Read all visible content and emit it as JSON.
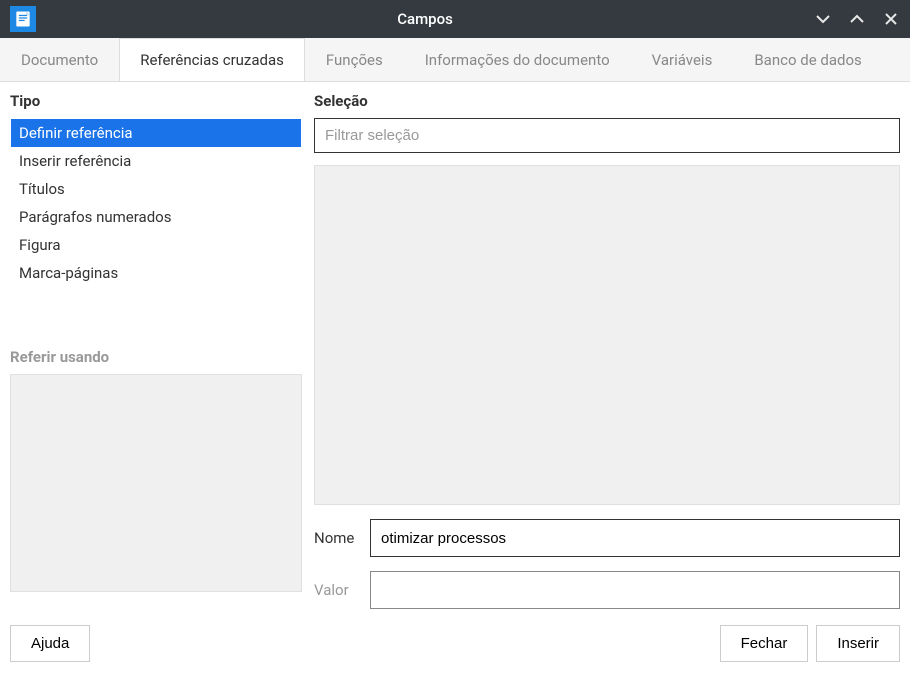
{
  "window": {
    "title": "Campos"
  },
  "tabs": [
    {
      "label": "Documento"
    },
    {
      "label": "Referências cruzadas"
    },
    {
      "label": "Funções"
    },
    {
      "label": "Informações do documento"
    },
    {
      "label": "Variáveis"
    },
    {
      "label": "Banco de dados"
    }
  ],
  "active_tab_index": 1,
  "left": {
    "type_header": "Tipo",
    "type_items": [
      "Definir referência",
      "Inserir referência",
      "Títulos",
      "Parágrafos numerados",
      "Figura",
      "Marca-páginas"
    ],
    "selected_type_index": 0,
    "refer_header": "Referir usando"
  },
  "right": {
    "selection_header": "Seleção",
    "filter_placeholder": "Filtrar seleção",
    "name_label": "Nome",
    "name_value": "otimizar processos",
    "value_label": "Valor",
    "value_value": ""
  },
  "footer": {
    "help": "Ajuda",
    "close": "Fechar",
    "insert": "Inserir"
  }
}
